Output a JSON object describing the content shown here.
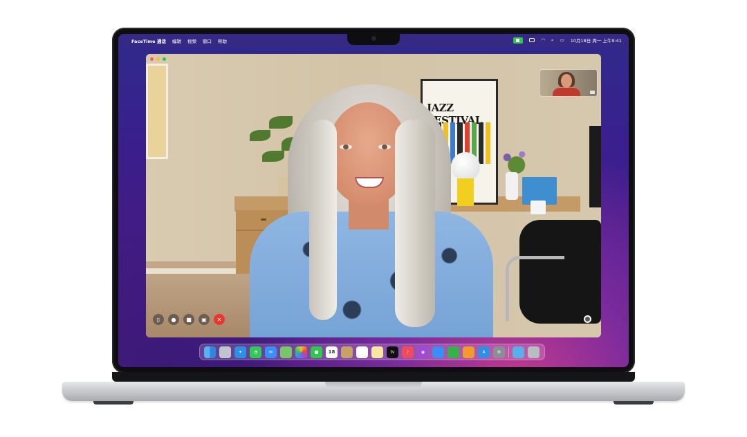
{
  "menubar": {
    "app_name": "FaceTime 通话",
    "menus": [
      "编辑",
      "视频",
      "窗口",
      "帮助"
    ],
    "clock": "10月18日 周一 上午9:41"
  },
  "facetime": {
    "poster_text": "JAZZ FESTIVAL"
  },
  "dock": {
    "calendar_day": "18",
    "tv_label": "tv"
  },
  "colors": {
    "facetime_green": "#2ec84a",
    "end_call_red": "#e8372e",
    "wallpaper_purple": "#3a1f8f"
  },
  "icons": {
    "menubar": [
      "apple-icon",
      "facetime-status-icon",
      "battery-icon",
      "wifi-icon",
      "search-icon",
      "control-center-icon"
    ],
    "controls": [
      "sidebar-icon",
      "microphone-icon",
      "camera-icon",
      "screen-share-icon",
      "end-call-icon",
      "shutter-icon"
    ]
  }
}
